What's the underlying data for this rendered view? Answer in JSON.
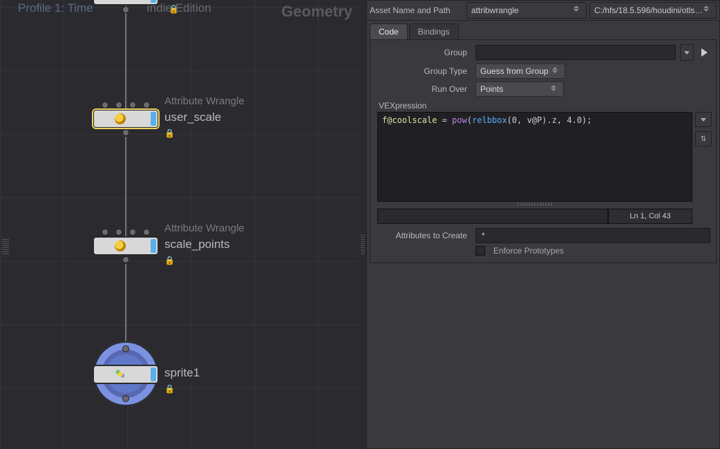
{
  "network": {
    "profile_label": "Profile 1: Time",
    "indie_label": "Indie Edition",
    "context_label": "Geometry",
    "nodes": [
      {
        "type": "",
        "name": "",
        "partial_top": true
      },
      {
        "type": "Attribute Wrangle",
        "name": "user_scale"
      },
      {
        "type": "Attribute Wrangle",
        "name": "scale_points"
      },
      {
        "type": "",
        "name": "sprite1",
        "display_ring": true
      }
    ],
    "lock_glyph": "🔒"
  },
  "params": {
    "asset_label": "Asset Name and Path",
    "asset_name": "attribwrangle",
    "asset_path": "C:/hfs/18.5.596/houdini/otls…",
    "tabs": [
      "Code",
      "Bindings"
    ],
    "active_tab": 0,
    "group_label": "Group",
    "group_value": "",
    "group_type_label": "Group Type",
    "group_type_value": "Guess from Group",
    "run_over_label": "Run Over",
    "run_over_value": "Points",
    "vex_label": "VEXpression",
    "vex_code_tokens": [
      {
        "t": "var",
        "s": "f@coolscale"
      },
      {
        "t": "lit",
        "s": " = "
      },
      {
        "t": "kw1",
        "s": "pow"
      },
      {
        "t": "lit",
        "s": "("
      },
      {
        "t": "fn",
        "s": "relbbox"
      },
      {
        "t": "lit",
        "s": "(0, v@P).z, 4.0);"
      }
    ],
    "cursor_status": "Ln 1, Col 43",
    "attrs_label": "Attributes to Create",
    "attrs_value": "*",
    "enforce_label": "Enforce Prototypes",
    "enforce_checked": false
  }
}
